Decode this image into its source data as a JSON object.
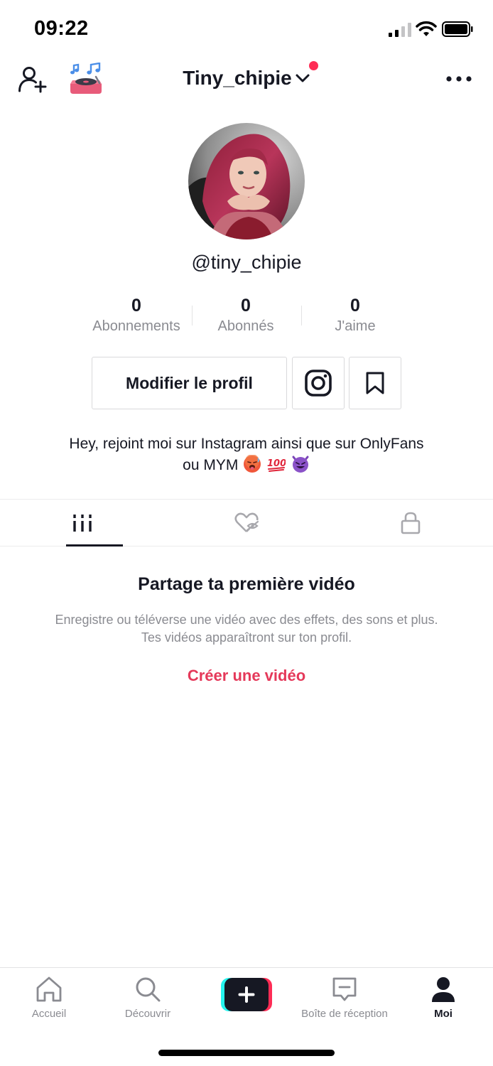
{
  "status_bar": {
    "time": "09:22"
  },
  "header": {
    "username": "Tiny_chipie"
  },
  "profile": {
    "handle": "@tiny_chipie",
    "stats": [
      {
        "value": "0",
        "label": "Abonnements"
      },
      {
        "value": "0",
        "label": "Abonnés"
      },
      {
        "value": "0",
        "label": "J'aime"
      }
    ],
    "edit_label": "Modifier le profil",
    "bio_line1": "Hey, rejoint moi sur Instagram ainsi que sur OnlyFans",
    "bio_line2": "ou MYM"
  },
  "tabs": [
    {
      "icon": "grid-icon",
      "active": true
    },
    {
      "icon": "hidden-likes-icon",
      "active": false
    },
    {
      "icon": "lock-icon",
      "active": false
    }
  ],
  "empty_state": {
    "title": "Partage ta première vidéo",
    "description": "Enregistre ou téléverse une vidéo avec des effets, des sons et plus. Tes vidéos apparaîtront sur ton profil.",
    "cta": "Créer une vidéo"
  },
  "bottom_nav": {
    "items": [
      {
        "label": "Accueil",
        "icon": "home-icon"
      },
      {
        "label": "Découvrir",
        "icon": "search-icon"
      },
      {
        "label": "Boîte de réception",
        "icon": "inbox-icon"
      },
      {
        "label": "Moi",
        "icon": "profile-icon"
      }
    ]
  },
  "colors": {
    "accent": "#fe2c55",
    "link": "#e5395a",
    "text": "#161823",
    "muted": "#8a8b91"
  }
}
